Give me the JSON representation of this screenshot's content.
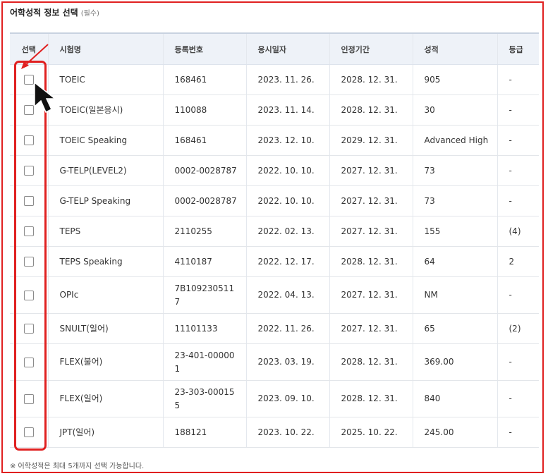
{
  "title": "어학성적 정보 선택",
  "title_required": "(필수)",
  "columns": [
    "선택",
    "시험명",
    "등록번호",
    "응시일자",
    "인정기간",
    "성적",
    "등급"
  ],
  "rows": [
    {
      "exam": "TOEIC",
      "reg": "168461",
      "date": "2023. 11. 26.",
      "valid": "2028. 12. 31.",
      "score": "905",
      "grade": "-"
    },
    {
      "exam": "TOEIC(일본응시)",
      "reg": "110088",
      "date": "2023. 11. 14.",
      "valid": "2028. 12. 31.",
      "score": "30",
      "grade": "-"
    },
    {
      "exam": "TOEIC Speaking",
      "reg": "168461",
      "date": "2023. 12. 10.",
      "valid": "2029. 12. 31.",
      "score": "Advanced High",
      "grade": "-"
    },
    {
      "exam": "G-TELP(LEVEL2)",
      "reg": "0002-0028787",
      "date": "2022. 10. 10.",
      "valid": "2027. 12. 31.",
      "score": "73",
      "grade": "-"
    },
    {
      "exam": "G-TELP Speaking",
      "reg": "0002-0028787",
      "date": "2022. 10. 10.",
      "valid": "2027. 12. 31.",
      "score": "73",
      "grade": "-"
    },
    {
      "exam": "TEPS",
      "reg": "2110255",
      "date": "2022. 02. 13.",
      "valid": "2027. 12. 31.",
      "score": "155",
      "grade": "(4)"
    },
    {
      "exam": "TEPS Speaking",
      "reg": "4110187",
      "date": "2022. 12. 17.",
      "valid": "2028. 12. 31.",
      "score": "64",
      "grade": "2"
    },
    {
      "exam": "OPIc",
      "reg": "7B109230511\n7",
      "date": "2022. 04. 13.",
      "valid": "2027. 12. 31.",
      "score": "NM",
      "grade": "-"
    },
    {
      "exam": "SNULT(일어)",
      "reg": "11101133",
      "date": "2022. 11. 26.",
      "valid": "2027. 12. 31.",
      "score": "65",
      "grade": "(2)"
    },
    {
      "exam": "FLEX(불어)",
      "reg": "23-401-00000\n1",
      "date": "2023. 03. 19.",
      "valid": "2028. 12. 31.",
      "score": "369.00",
      "grade": "-"
    },
    {
      "exam": "FLEX(일어)",
      "reg": "23-303-00015\n5",
      "date": "2023. 09. 10.",
      "valid": "2028. 12. 31.",
      "score": "840",
      "grade": "-"
    },
    {
      "exam": "JPT(일어)",
      "reg": "188121",
      "date": "2023. 10. 22.",
      "valid": "2025. 10. 22.",
      "score": "245.00",
      "grade": "-"
    }
  ],
  "note": "※ 어학성적은 최대 5개까지 선택 가능합니다.",
  "colors": {
    "highlight": "#e02020",
    "header_bg": "#eef2f8"
  },
  "icons": {
    "cursor": "mouse-pointer-icon",
    "annotation_arrow": "red-arrow-icon"
  }
}
